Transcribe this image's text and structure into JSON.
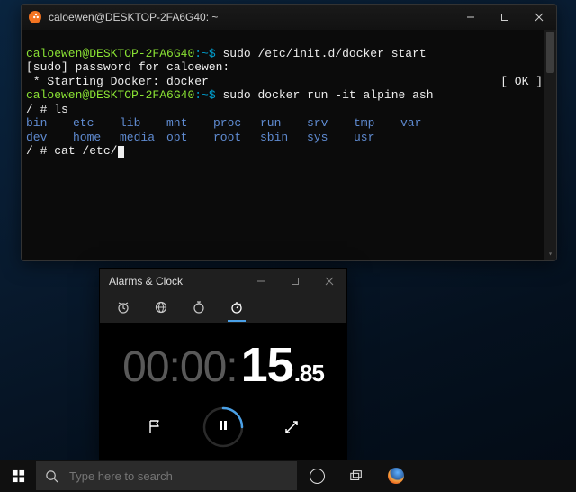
{
  "terminal": {
    "title": "caloewen@DESKTOP-2FA6G40: ~",
    "prompt_user": "caloewen",
    "prompt_host": "@DESKTOP-2FA6G40",
    "prompt_symbol": ":~$ ",
    "line1_cmd": "sudo /etc/init.d/docker start",
    "line2": "[sudo] password for caloewen:",
    "line3": " * Starting Docker: docker",
    "line3_ok": "[ OK ]",
    "line4_cmd": "sudo docker run -it alpine ash",
    "line5": "/ # ",
    "line5_cmd": "ls",
    "ls_row1": [
      "bin",
      "etc",
      "lib",
      "mnt",
      "proc",
      "run",
      "srv",
      "tmp",
      "var"
    ],
    "ls_row2": [
      "dev",
      "home",
      "media",
      "opt",
      "root",
      "sbin",
      "sys",
      "usr",
      ""
    ],
    "line8": "/ # ",
    "line8_cmd": "cat /etc/"
  },
  "clock": {
    "title": "Alarms & Clock",
    "time_hhmm": "00:00:",
    "time_ss": "15",
    "time_cs": ".85"
  },
  "taskbar": {
    "search_placeholder": "Type here to search"
  }
}
